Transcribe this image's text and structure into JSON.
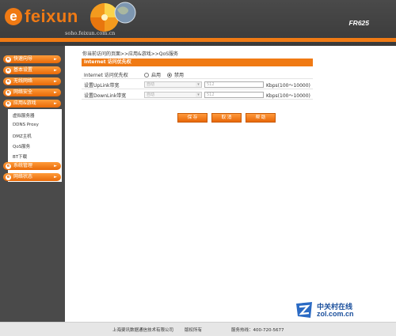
{
  "header": {
    "logo_letter": "e",
    "logo_text": "feixun",
    "domain": "soho.feixun.com.cn",
    "model": "FR625"
  },
  "sidebar": {
    "items": [
      {
        "label": "快速向导",
        "icon": "e"
      },
      {
        "label": "基本设置",
        "icon": "e"
      },
      {
        "label": "无线网络",
        "icon": "e"
      },
      {
        "label": "网络安全",
        "icon": "e"
      },
      {
        "label": "应用&游戏",
        "icon": "e"
      },
      {
        "label": "系统管理",
        "icon": "e"
      },
      {
        "label": "网络状态",
        "icon": "e"
      }
    ],
    "arrow": "►",
    "submenu": [
      "虚拟服务器",
      "DDNS Proxy",
      "DMZ主机",
      "QoS服务",
      "BT下载"
    ]
  },
  "main": {
    "breadcrumb": "你当前访问的页面>>应用&游戏>>QoS服务",
    "section_title": "Internet 访问优先权",
    "priority_row": {
      "label": "Internet 访问优先权",
      "options": [
        "启用",
        "禁用"
      ],
      "selected": "禁用"
    },
    "uplink_row": {
      "label": "设置UpLink带宽",
      "select_value": "自动",
      "input_value": "512",
      "unit": "Kbps(100～10000)"
    },
    "downlink_row": {
      "label": "设置DownLink带宽",
      "select_value": "自动",
      "input_value": "512",
      "unit": "Kbps(100～10000)"
    },
    "buttons": {
      "save": "保 存",
      "cancel": "取 消",
      "help": "帮 助"
    }
  },
  "watermark": {
    "cn": "中关村在线",
    "en": "zol.com.cn"
  },
  "footer": {
    "company": "上海斐讯数据通信技术有限公司",
    "copyright": "版权所有",
    "hotline": "服务热线：400-720-5677"
  },
  "colors": {
    "accent": "#f07a14",
    "header": "#3f3f3f",
    "sidebar": "#4a4a4a"
  }
}
